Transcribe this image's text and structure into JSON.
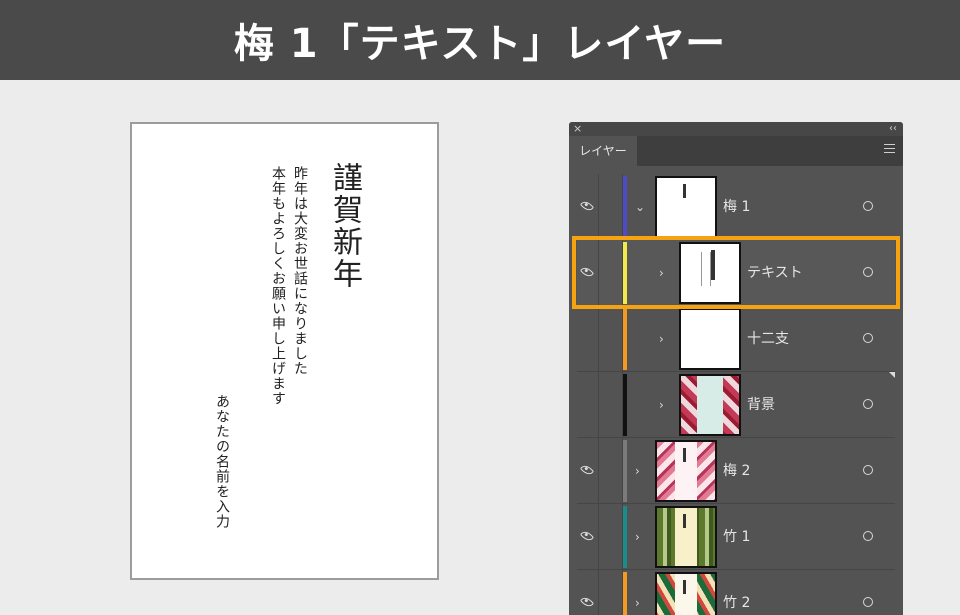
{
  "banner": {
    "title": "梅 1「テキスト」レイヤー"
  },
  "card": {
    "greeting": "謹賀新年",
    "message_line1": "昨年は大変お世話になりました",
    "message_line2": "本年もよろしくお願い申し上げます",
    "sender": "あなたの名前を入力"
  },
  "panel": {
    "tab_label": "レイヤー",
    "close_icon": "×",
    "collapse_icon": "‹‹",
    "layers": [
      {
        "name": "梅 1",
        "visible": true,
        "expanded": true,
        "color": "#4e4cc4",
        "thumb": "card-white"
      },
      {
        "name": "テキスト",
        "visible": true,
        "expanded": false,
        "color": "#f2e94a",
        "thumb": "text"
      },
      {
        "name": "十二支",
        "visible": false,
        "expanded": false,
        "color": "#f39a1f",
        "thumb": "blank"
      },
      {
        "name": "背景",
        "visible": false,
        "expanded": false,
        "color": "#111111",
        "thumb": "floral"
      },
      {
        "name": "梅 2",
        "visible": true,
        "expanded": false,
        "color": "#7b7b7b",
        "thumb": "ume2"
      },
      {
        "name": "竹 1",
        "visible": true,
        "expanded": false,
        "color": "#1a8d8a",
        "thumb": "bamboo"
      },
      {
        "name": "竹 2",
        "visible": true,
        "expanded": false,
        "color": "#f39a1f",
        "thumb": "take2"
      }
    ],
    "selected_layer": "テキスト",
    "highlight_color": "#f5a310"
  },
  "icons": {
    "chevron_right": "›",
    "chevron_down": "⌄"
  }
}
